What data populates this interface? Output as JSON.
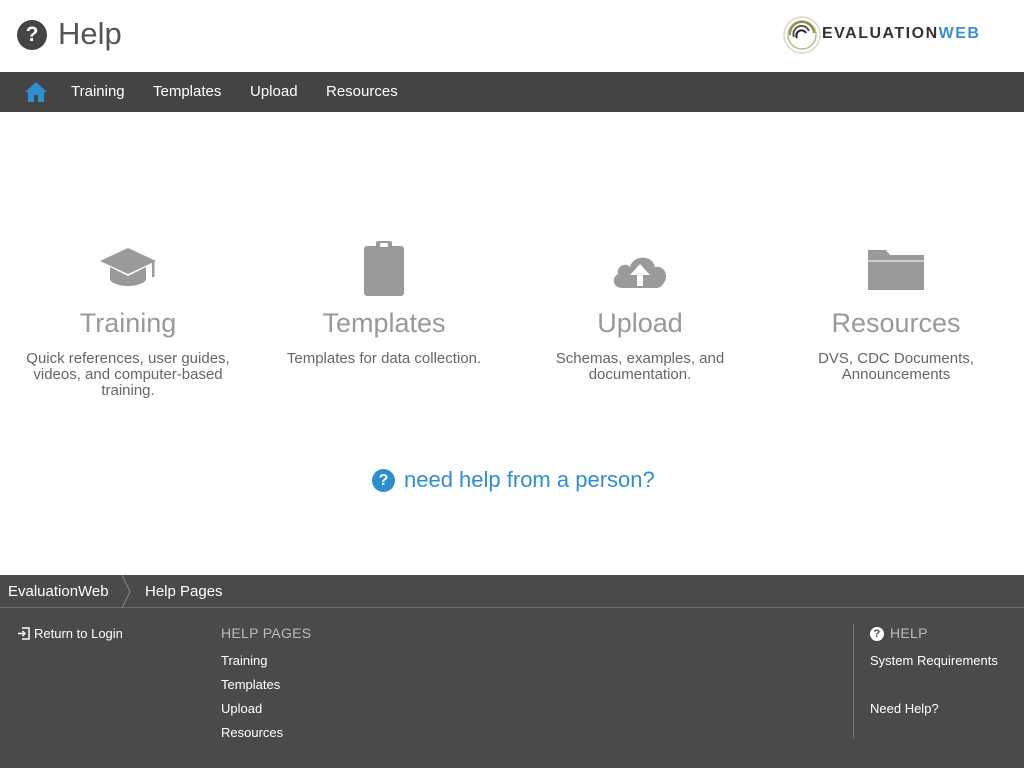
{
  "header": {
    "title": "Help",
    "logo_part1": "EVALUATION",
    "logo_part2": "WEB"
  },
  "nav": {
    "items": [
      "Training",
      "Templates",
      "Upload",
      "Resources"
    ]
  },
  "cards": [
    {
      "icon": "graduation-cap-icon",
      "title": "Training",
      "desc": "Quick references, user guides, videos, and computer-based training."
    },
    {
      "icon": "clipboard-icon",
      "title": "Templates",
      "desc": "Templates for data collection."
    },
    {
      "icon": "cloud-upload-icon",
      "title": "Upload",
      "desc": "Schemas, examples, and documentation."
    },
    {
      "icon": "folder-icon",
      "title": "Resources",
      "desc": "DVS, CDC Documents, Announcements"
    }
  ],
  "help_link": "need help from a person?",
  "footer": {
    "breadcrumb": [
      "EvaluationWeb",
      "Help Pages"
    ],
    "return_label": "Return to Login",
    "help_pages_heading": "HELP PAGES",
    "help_pages": [
      "Training",
      "Templates",
      "Upload",
      "Resources"
    ],
    "help_heading": "HELP",
    "help_links": [
      "System Requirements",
      "Need Help?"
    ]
  },
  "colors": {
    "nav_bg": "#444444",
    "accent": "#2e8fd0",
    "footer_bg": "#4a4a4a",
    "icon_gray": "#9a9a9a"
  }
}
